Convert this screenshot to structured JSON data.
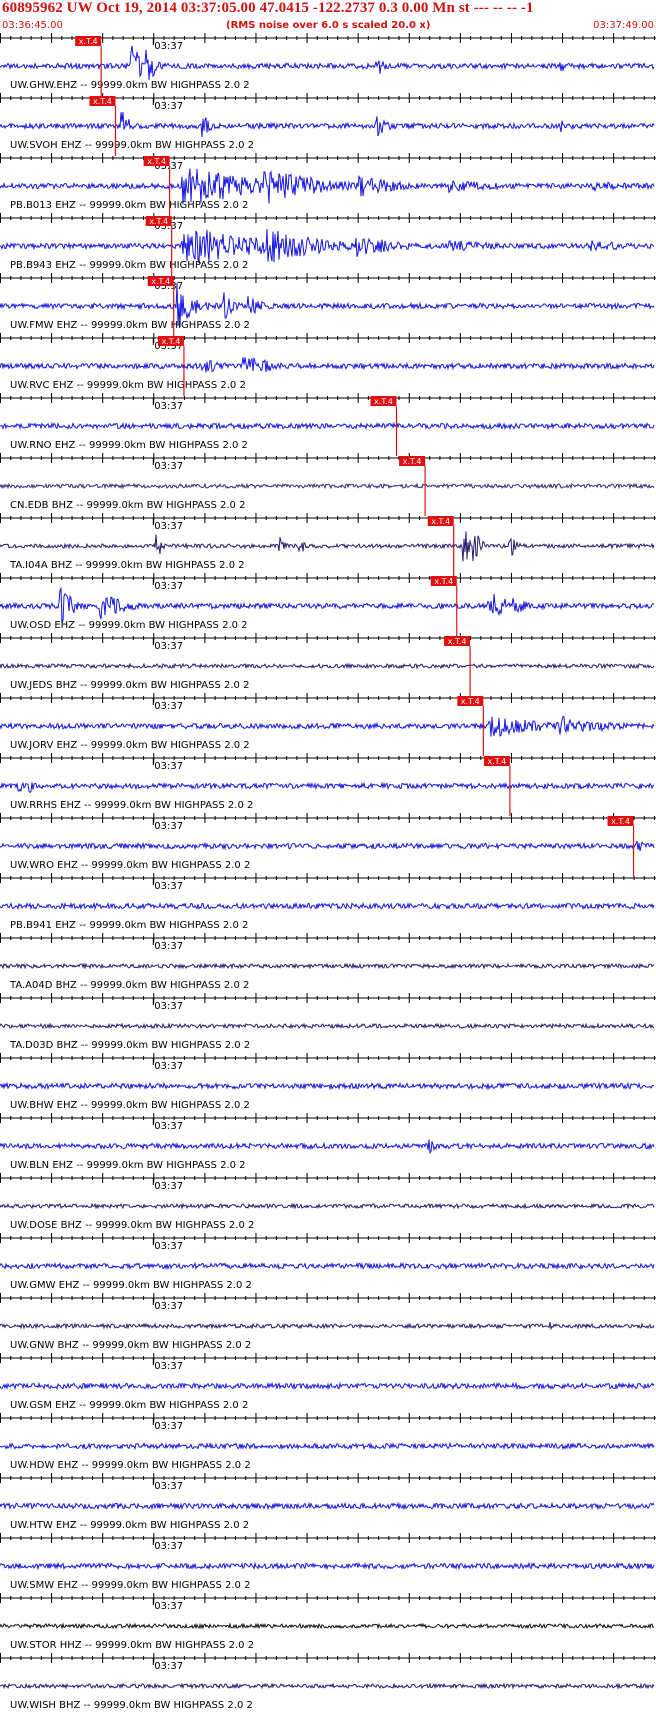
{
  "header": {
    "title": "60895962 UW Oct 19, 2014 03:37:05.00   47.0415 -122.2737  0.3 0.00 Mn st --- -- --  -1",
    "start_time": "03:36:45.00",
    "rms_note": "(RMS noise over 6.0 s scaled 20.0 x)",
    "end_time": "03:37:49.00"
  },
  "chart_data": {
    "type": "seismogram-record-section",
    "event_id": "60895962",
    "network": "UW",
    "origin_date": "Oct 19, 2014",
    "origin_time": "03:37:05.00",
    "latitude": 47.0415,
    "longitude": -122.2737,
    "depth": 0.3,
    "magnitude": 0.0,
    "magnitude_type": "Mn",
    "x_start": "03:36:45.00",
    "x_end": "03:37:49.00",
    "x_range_seconds": [
      0,
      64
    ],
    "minute_mark_label": "03:37",
    "minute_mark_seconds": 15,
    "major_tick_seconds": 5,
    "minor_tick_seconds": 1,
    "rms_window_seconds": 6.0,
    "rms_scale": 20.0,
    "pick_label": "x.T.4",
    "filter_text": "99999.0km BW  HIGHPASS  2.0  2",
    "traces": [
      {
        "station": "UW.GHW.EHZ --",
        "color": "#1515e6",
        "pick_seconds": 9.9,
        "events": [
          [
            13,
            3.0,
            0.8
          ],
          [
            14.5,
            2.5,
            0.7
          ],
          [
            37,
            1.5,
            0.5
          ],
          [
            55,
            0.9,
            0.4
          ]
        ]
      },
      {
        "station": "UW.SVOH EHZ --",
        "color": "#1515e6",
        "pick_seconds": 11.3,
        "events": [
          [
            12,
            2.0,
            0.7
          ],
          [
            20,
            1.4,
            0.6
          ],
          [
            37,
            1.8,
            0.8
          ],
          [
            55,
            1.0,
            0.3
          ]
        ]
      },
      {
        "station": "PB.B013 EHZ --",
        "color": "#1515e6",
        "pick_seconds": 16.6,
        "events": [
          [
            18,
            2.6,
            8.0
          ],
          [
            26,
            2.3,
            5.5
          ],
          [
            35,
            1.4,
            4.0
          ],
          [
            44,
            0.8,
            6.0
          ],
          [
            58,
            0.7,
            5.0
          ]
        ]
      },
      {
        "station": "PB.B943 EHZ --",
        "color": "#1515e6",
        "pick_seconds": 16.8,
        "events": [
          [
            18,
            2.6,
            8.0
          ],
          [
            26,
            2.3,
            5.5
          ],
          [
            35,
            1.4,
            4.0
          ],
          [
            44,
            0.8,
            6.0
          ],
          [
            58,
            0.7,
            5.0
          ]
        ]
      },
      {
        "station": "UW.FMW EHZ --",
        "color": "#1515e6",
        "pick_seconds": 17.0,
        "events": [
          [
            17.5,
            2.8,
            1.5
          ],
          [
            22,
            1.8,
            1.0
          ],
          [
            24.5,
            1.6,
            1.0
          ]
        ]
      },
      {
        "station": "UW.RVC EHZ --",
        "color": "#1515e6",
        "pick_seconds": 18.0,
        "events": [
          [
            20,
            1.0,
            2.0
          ],
          [
            24,
            1.4,
            2.5
          ],
          [
            26,
            0.8,
            1.5
          ]
        ]
      },
      {
        "station": "UW.RNO EHZ --",
        "color": "#1515e6",
        "pick_seconds": 38.8,
        "events": []
      },
      {
        "station": "CN.EDB BHZ --",
        "color": "#3a2a7a",
        "pick_seconds": 41.6,
        "events": []
      },
      {
        "station": "TA.I04A BHZ --",
        "color": "#2a1a6e",
        "pick_seconds": 44.4,
        "events": [
          [
            15.5,
            2.0,
            0.4
          ],
          [
            27.5,
            1.4,
            0.5
          ],
          [
            29.5,
            1.2,
            0.5
          ],
          [
            45.5,
            3.0,
            0.6
          ],
          [
            46.5,
            2.8,
            0.6
          ],
          [
            50,
            2.0,
            0.6
          ]
        ]
      },
      {
        "station": "UW.OSD EHZ --",
        "color": "#1515e6",
        "pick_seconds": 44.7,
        "events": [
          [
            6,
            2.4,
            1.2
          ],
          [
            10,
            2.0,
            2.0
          ],
          [
            48,
            2.2,
            1.5
          ],
          [
            50,
            1.4,
            1.5
          ]
        ]
      },
      {
        "station": "UW.JEDS BHZ --",
        "color": "#2a1a6e",
        "pick_seconds": 46.0,
        "events": []
      },
      {
        "station": "UW.JORV EHZ --",
        "color": "#1515e6",
        "pick_seconds": 47.3,
        "events": [
          [
            48,
            1.4,
            6.0
          ],
          [
            55,
            1.2,
            5.0
          ]
        ]
      },
      {
        "station": "UW.RRHS EHZ --",
        "color": "#1515e6",
        "pick_seconds": 49.9,
        "events": [
          [
            2,
            1.0,
            0.3
          ],
          [
            3,
            1.0,
            0.3
          ],
          [
            52,
            0.4,
            2.0
          ]
        ]
      },
      {
        "station": "UW.WRO EHZ --",
        "color": "#1515e6",
        "pick_seconds": 62.0,
        "events": [
          [
            62.5,
            1.0,
            0.8
          ]
        ]
      },
      {
        "station": "PB.B941 EHZ --",
        "color": "#1515e6",
        "pick_seconds": null,
        "events": []
      },
      {
        "station": "TA.A04D BHZ --",
        "color": "#2a1a6e",
        "pick_seconds": null,
        "events": []
      },
      {
        "station": "TA.D03D BHZ --",
        "color": "#2a1a6e",
        "pick_seconds": null,
        "events": []
      },
      {
        "station": "UW.BHW EHZ --",
        "color": "#1515e6",
        "pick_seconds": null,
        "events": []
      },
      {
        "station": "UW.BLN EHZ --",
        "color": "#1515e6",
        "pick_seconds": null,
        "events": [
          [
            42,
            0.9,
            1.0
          ]
        ]
      },
      {
        "station": "UW.DOSE BHZ --",
        "color": "#2a1a6e",
        "pick_seconds": null,
        "events": []
      },
      {
        "station": "UW.GMW EHZ --",
        "color": "#1515e6",
        "pick_seconds": null,
        "events": []
      },
      {
        "station": "UW.GNW BHZ --",
        "color": "#2a1a6e",
        "pick_seconds": null,
        "events": [
          [
            54,
            0.8,
            0.5
          ]
        ]
      },
      {
        "station": "UW.GSM EHZ --",
        "color": "#1515e6",
        "pick_seconds": null,
        "events": []
      },
      {
        "station": "UW.HDW EHZ --",
        "color": "#1515e6",
        "pick_seconds": null,
        "events": []
      },
      {
        "station": "UW.HTW EHZ --",
        "color": "#1515e6",
        "pick_seconds": null,
        "events": []
      },
      {
        "station": "UW.SMW EHZ --",
        "color": "#1515e6",
        "pick_seconds": null,
        "events": []
      },
      {
        "station": "UW.STOR HHZ --",
        "color": "#101010",
        "pick_seconds": null,
        "events": []
      },
      {
        "station": "UW.WISH BHZ --",
        "color": "#2a1a6e",
        "pick_seconds": null,
        "events": []
      }
    ]
  }
}
